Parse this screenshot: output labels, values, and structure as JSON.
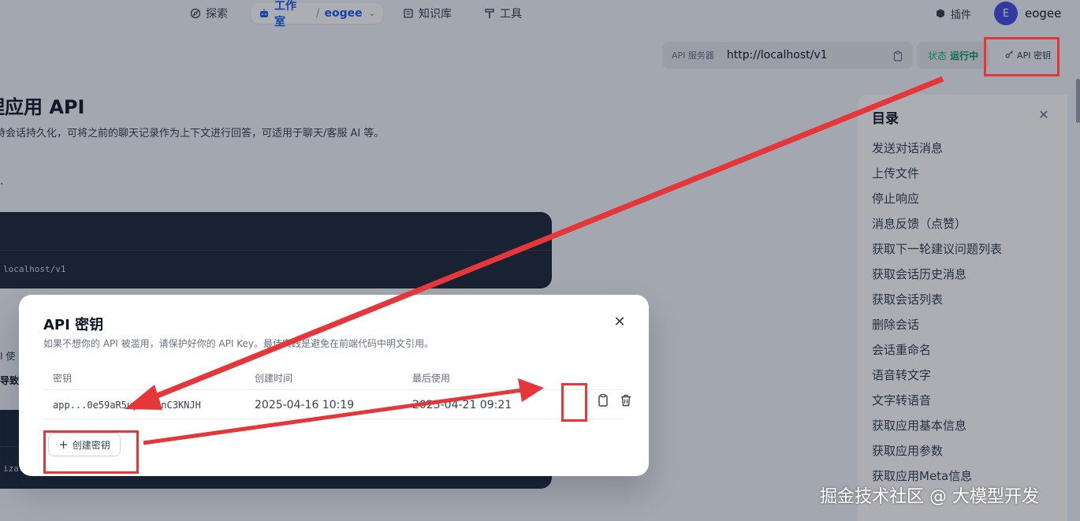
{
  "nav": {
    "explore": "探索",
    "studio": "工作室",
    "app_name": "eogee",
    "knowledge": "知识库",
    "tools": "工具",
    "plugins": "插件",
    "avatar_letter": "E",
    "user_name": "eogee"
  },
  "api_bar": {
    "server_label": "API 服务器",
    "server_url": "http://localhost/v1",
    "status_label": "状态",
    "status_value": "运行中",
    "api_key_label": "API 密钥"
  },
  "doc": {
    "title": "理应用 API",
    "description": "持会话持久化，可将之前的聊天记录作为上下文进行回答，可适用于聊天/客服 AI 等。",
    "code_text": "localhost/v1",
    "fragment1": "I 使",
    "fragment2": "导致",
    "code_text2": "izat"
  },
  "toc": {
    "title": "目录",
    "items": [
      "发送对话消息",
      "上传文件",
      "停止响应",
      "消息反馈（点赞）",
      "获取下一轮建议问题列表",
      "获取会话历史消息",
      "获取会话列表",
      "删除会话",
      "会话重命名",
      "语音转文字",
      "文字转语音",
      "获取应用基本信息",
      "获取应用参数",
      "获取应用Meta信息"
    ]
  },
  "modal": {
    "title": "API 密钥",
    "subtitle": "如果不想你的 API 被滥用，请保护好你的 API Key。最佳实践是避免在前端代码中明文引用。",
    "col_key": "密钥",
    "col_created": "创建时间",
    "col_last_used": "最后使用",
    "rows": [
      {
        "key": "app...0e59aR5uymtGfnC3KNJH",
        "created": "2025-04-16 10:19",
        "last_used": "2025-04-21 09:21"
      }
    ],
    "create_label": "创建密钥"
  },
  "watermark": "掘金技术社区 @ 大模型开发",
  "colors": {
    "accent": "#155eef",
    "running": "#039855",
    "annotation": "#e5363a"
  }
}
